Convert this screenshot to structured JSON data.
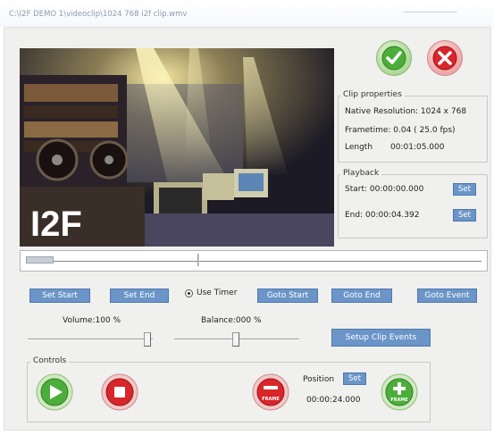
{
  "window": {
    "title": "C:\\I2F DEMO 1\\videoclip\\1024 768 i2f clip.wmv"
  },
  "video": {
    "logo_text": "I2F"
  },
  "icons": {
    "ok": "check-circle-icon",
    "cancel": "close-circle-icon",
    "play": "play-icon",
    "stop": "stop-icon",
    "frame_back": "frame-back-icon",
    "frame_forward": "frame-forward-icon"
  },
  "clip_properties": {
    "label": "Clip properties",
    "native_resolution": "Native Resolution: 1024 x 768",
    "frametime": "Frametime:  0.04 ( 25.0 fps)",
    "length_label": "Length",
    "length_value": "00:01:05.000"
  },
  "playback": {
    "label": "Playback",
    "start": "Start: 00:00:00.000",
    "end": "End:  00:00:04.392",
    "set_label": "Set"
  },
  "seek": {
    "position_fraction": 0.38,
    "range_end_fraction": 0.07
  },
  "buttons": {
    "set_start": "Set Start",
    "set_end": "Set End",
    "use_timer": "Use Timer",
    "goto_start": "Goto Start",
    "goto_end": "Goto End",
    "goto_event": "Goto Event",
    "setup_clip_events": "Setup Clip Events"
  },
  "volume": {
    "label": "Volume:100 %",
    "level": 1.0
  },
  "balance": {
    "label": "Balance:000 %",
    "level": 0.5
  },
  "controls": {
    "label": "Controls",
    "position_label": "Position",
    "set_label": "Set",
    "position_value": "00:00:24.000",
    "frame_text": "FRAME"
  },
  "colors": {
    "button_blue": "#6b95c8",
    "ok_green": "#4cae3a",
    "cancel_red": "#d8262a"
  }
}
